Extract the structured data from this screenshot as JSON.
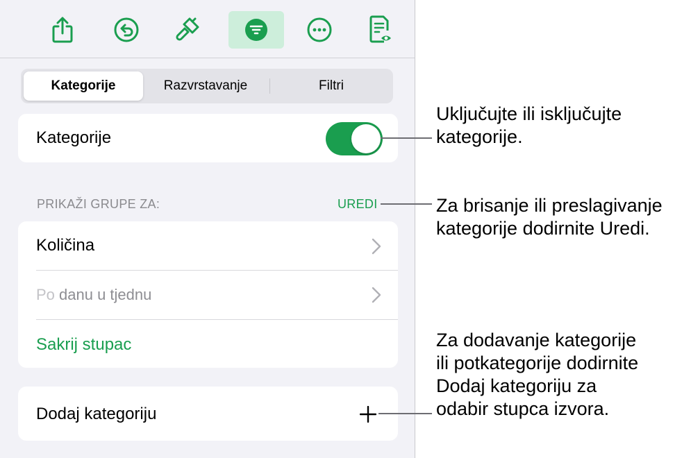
{
  "toolbar": {
    "buttons": [
      {
        "name": "share-icon"
      },
      {
        "name": "undo-icon"
      },
      {
        "name": "paintbrush-icon"
      },
      {
        "name": "organize-icon",
        "active": true
      },
      {
        "name": "more-icon"
      },
      {
        "name": "reading-view-icon"
      }
    ]
  },
  "tabs": [
    {
      "label": "Kategorije",
      "selected": true
    },
    {
      "label": "Razvrstavanje",
      "selected": false
    },
    {
      "label": "Filtri",
      "selected": false
    }
  ],
  "categories_toggle": {
    "label": "Kategorije",
    "on": true
  },
  "group_section": {
    "header": "PRIKAŽI GRUPE ZA:",
    "edit_label": "UREDI",
    "rows": [
      {
        "label": "Količina"
      },
      {
        "label_prefix": "Po",
        "label_rest": " danu u tjednu"
      }
    ],
    "hide_column": "Sakrij stupac"
  },
  "add_category": {
    "label": "Dodaj kategoriju"
  },
  "callouts": {
    "toggle": "Uključujte ili isključujte\nkategorije.",
    "edit": "Za brisanje ili preslagivanje\nkategorije dodirnite Uredi.",
    "add": "Za dodavanje kategorije\nili potkategorije dodirnite\nDodaj kategoriju za\nodabir stupca izvora."
  },
  "colors": {
    "accent": "#1a9e4f",
    "active_tab_bg": "#cdeedb",
    "panel_bg": "#f2f2f7"
  }
}
